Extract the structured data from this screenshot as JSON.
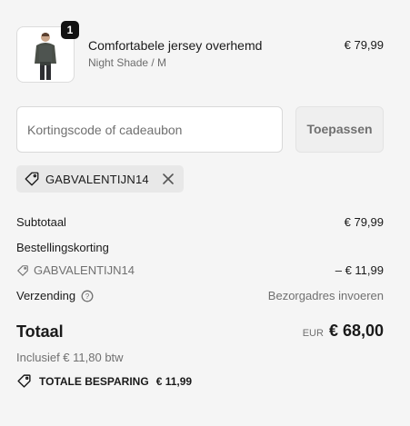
{
  "cart_item": {
    "quantity": "1",
    "title": "Comfortabele jersey overhemd",
    "variant": "Night Shade / M",
    "price": "€ 79,99"
  },
  "discount_form": {
    "placeholder": "Kortingscode of cadeaubon",
    "apply_label": "Toepassen"
  },
  "applied_code": {
    "label": "GABVALENTIJN14"
  },
  "summary": {
    "subtotal_label": "Subtotaal",
    "subtotal_value": "€ 79,99",
    "order_discount_label": "Bestellingskorting",
    "discount_code": "GABVALENTIJN14",
    "discount_amount": "– € 11,99",
    "shipping_label": "Verzending",
    "shipping_value": "Bezorgadres invoeren",
    "total_label": "Totaal",
    "currency": "EUR",
    "total_value": "€ 68,00",
    "tax_note": "Inclusief € 11,80 btw",
    "savings_label": "TOTALE BESPARING",
    "savings_amount": "€ 11,99"
  },
  "icons": {
    "tag": "tag-icon",
    "close": "close-icon",
    "info": "info-icon"
  }
}
